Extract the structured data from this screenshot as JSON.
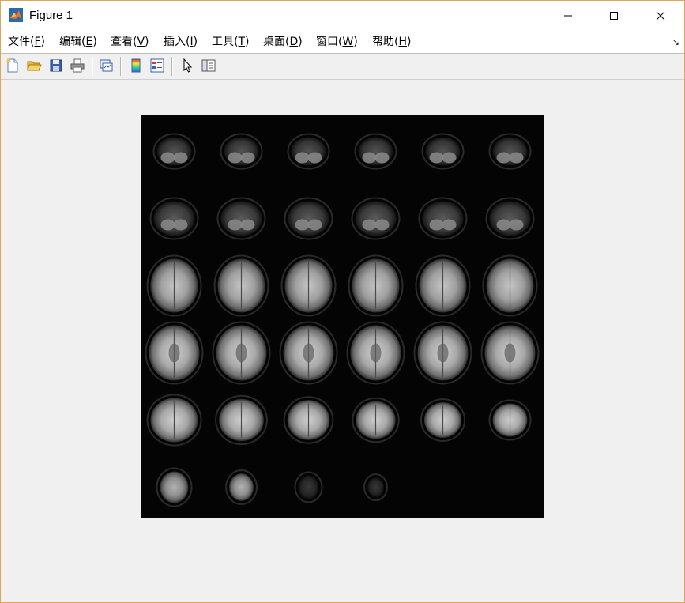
{
  "window": {
    "title": "Figure 1"
  },
  "menu": [
    {
      "label": "文件(",
      "key": "F",
      "end": ")"
    },
    {
      "label": "编辑(",
      "key": "E",
      "end": ")"
    },
    {
      "label": "查看(",
      "key": "V",
      "end": ")"
    },
    {
      "label": "插入(",
      "key": "I",
      "end": ")"
    },
    {
      "label": "工具(",
      "key": "T",
      "end": ")"
    },
    {
      "label": "桌面(",
      "key": "D",
      "end": ")"
    },
    {
      "label": "窗口(",
      "key": "W",
      "end": ")"
    },
    {
      "label": "帮助(",
      "key": "H",
      "end": ")"
    }
  ],
  "toolbar": {
    "buttons": [
      "new-figure-icon",
      "open-file-icon",
      "save-icon",
      "print-icon",
      "link-plot-icon",
      "colorbar-icon",
      "legend-icon",
      "pointer-icon",
      "property-inspector-icon"
    ]
  },
  "montage": {
    "grid_columns": 6,
    "grid_rows": 6,
    "slice_count": 34,
    "colormap": "gray"
  },
  "colors": {
    "window_border": "#e0a55a",
    "background": "#f0f0f0",
    "axes_background": "#040404"
  }
}
